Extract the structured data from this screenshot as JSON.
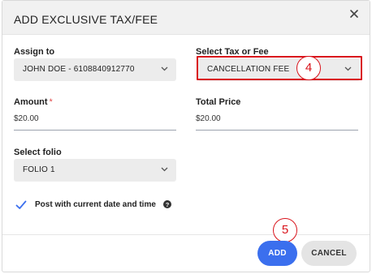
{
  "dialog": {
    "title": "ADD EXCLUSIVE TAX/FEE",
    "close_icon": "close-icon"
  },
  "form": {
    "assign_to": {
      "label": "Assign to",
      "value": "JOHN DOE - 6108840912770"
    },
    "tax_or_fee": {
      "label": "Select Tax or Fee",
      "value": "CANCELLATION FEE"
    },
    "amount": {
      "label": "Amount",
      "required_marker": "*",
      "value": "$20.00"
    },
    "total_price": {
      "label": "Total Price",
      "value": "$20.00"
    },
    "folio": {
      "label": "Select folio",
      "value": "FOLIO 1"
    },
    "post_now": {
      "label": "Post with current date and time",
      "checked": true,
      "help_icon": "help-icon"
    }
  },
  "actions": {
    "add_label": "ADD",
    "cancel_label": "CANCEL"
  },
  "annotations": {
    "step_4": "4",
    "step_5": "5",
    "accent_color": "#d9141c"
  },
  "colors": {
    "primary": "#3b6fee",
    "required": "#e24a4a",
    "header_bg": "#f1f1f1"
  }
}
